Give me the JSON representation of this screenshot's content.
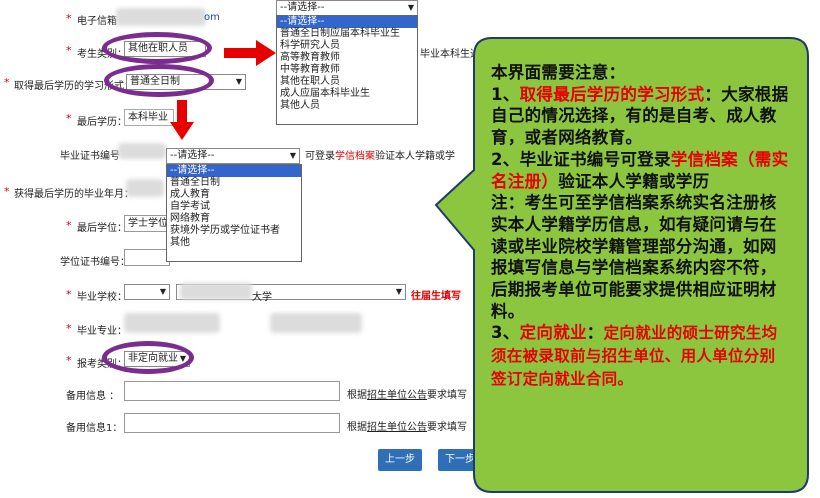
{
  "form": {
    "email": {
      "label": "电子信箱",
      "value": "om"
    },
    "candidate_type": {
      "label": "考生类别：",
      "value": "其他在职人员",
      "note": "毕业本科生选 “其"
    },
    "study_form": {
      "label": "取得最后学历的学习形式：",
      "value": "普通全日制"
    },
    "last_education": {
      "label": "最后学历：",
      "value": "本科毕业"
    },
    "diploma_no": {
      "label": "毕业证书编号",
      "select": "--请选择--",
      "note_prefix": "可登录",
      "note_link": "学信档案",
      "note_suffix": "验证本人学籍或学"
    },
    "grad_date": {
      "label": "获得最后学历的毕业年月："
    },
    "last_degree": {
      "label": "最后学位：",
      "value": "学士学位"
    },
    "degree_no": {
      "label": "学位证书编号："
    },
    "grad_school": {
      "label": "毕业学校：",
      "value_suffix": "大学",
      "note": "往届生填写"
    },
    "grad_major": {
      "label": "毕业专业："
    },
    "apply_category": {
      "label": "报考类别：",
      "value": "非定向就业"
    },
    "extra1": {
      "label": "备用信息 ：",
      "note_prefix": "根据",
      "note_link": "招生单位公告",
      "note_suffix": "要求填写"
    },
    "extra2": {
      "label": "备用信息1：",
      "note_prefix": "根据",
      "note_link": "招生单位公告",
      "note_suffix": "要求填写"
    }
  },
  "dropdown_candidate": {
    "selected": "--请选择--",
    "options": [
      "--请选择--",
      "普通全日制应届本科毕业生",
      "科学研究人员",
      "高等教育教师",
      "中等教育教师",
      "其他在职人员",
      "成人应届本科毕业生",
      "其他人员"
    ]
  },
  "dropdown_study_form": {
    "options": [
      "--请选择--",
      "普通全日制",
      "成人教育",
      "自学考试",
      "网络教育",
      "获境外学历或学位证书者",
      "其他"
    ]
  },
  "buttons": {
    "prev": "上一步",
    "next": "下一步"
  },
  "callout": {
    "title": "本界面需要注意：",
    "p1_num": "1、",
    "p1_red": "取得最后学历的学习形式",
    "p1_rest": "：大家根据自己的情况选择，有的是自考、成人教育，或者网络教育。",
    "p2_num": "2、毕业证书编号可登录",
    "p2_red": "学信档案（需实名注册）",
    "p2_rest": "验证本人学籍或学历",
    "note": "注：考生可至学信档案系统实名注册核实本人学籍学历信息，如有疑问请与在读或毕业院校学籍管理部分沟通，如网报填写信息与学信档案系统内容不符，后期报考单位可能要求提供相应证明材料。",
    "p3_num": "3、",
    "p3_red1": "定向就业",
    "p3_mid": "：",
    "p3_red2": "定向就业的硕士研究生均须在被录取前与招生单位、用人单位分别签订定向就业合同。"
  },
  "colors": {
    "callout_fill": "#8cc63f",
    "oval": "#7b2d8f",
    "arrow": "#e60000",
    "button": "#2f6fb8"
  }
}
